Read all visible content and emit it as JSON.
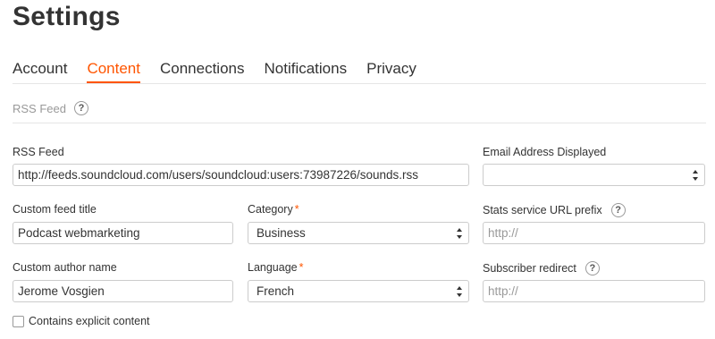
{
  "page_title": "Settings",
  "tabs": [
    {
      "label": "Account",
      "active": false
    },
    {
      "label": "Content",
      "active": true
    },
    {
      "label": "Connections",
      "active": false
    },
    {
      "label": "Notifications",
      "active": false
    },
    {
      "label": "Privacy",
      "active": false
    }
  ],
  "accent_color": "#ff5500",
  "section": {
    "label": "RSS Feed",
    "help_icon": "question-icon",
    "help_glyph": "?"
  },
  "form": {
    "rss_feed": {
      "label": "RSS Feed",
      "value": "http://feeds.soundcloud.com/users/soundcloud:users:73987226/sounds.rss"
    },
    "email_displayed": {
      "label": "Email Address Displayed",
      "value": ""
    },
    "custom_feed_title": {
      "label": "Custom feed title",
      "value": "Podcast webmarketing"
    },
    "category": {
      "label": "Category",
      "required_mark": "*",
      "value": "Business"
    },
    "stats_prefix": {
      "label": "Stats service URL prefix",
      "placeholder": "http://"
    },
    "custom_author": {
      "label": "Custom author name",
      "value": "Jerome Vosgien"
    },
    "language": {
      "label": "Language",
      "required_mark": "*",
      "value": "French"
    },
    "subscriber_redirect": {
      "label": "Subscriber redirect",
      "placeholder": "http://"
    },
    "explicit": {
      "label": "Contains explicit content",
      "checked": false
    }
  }
}
